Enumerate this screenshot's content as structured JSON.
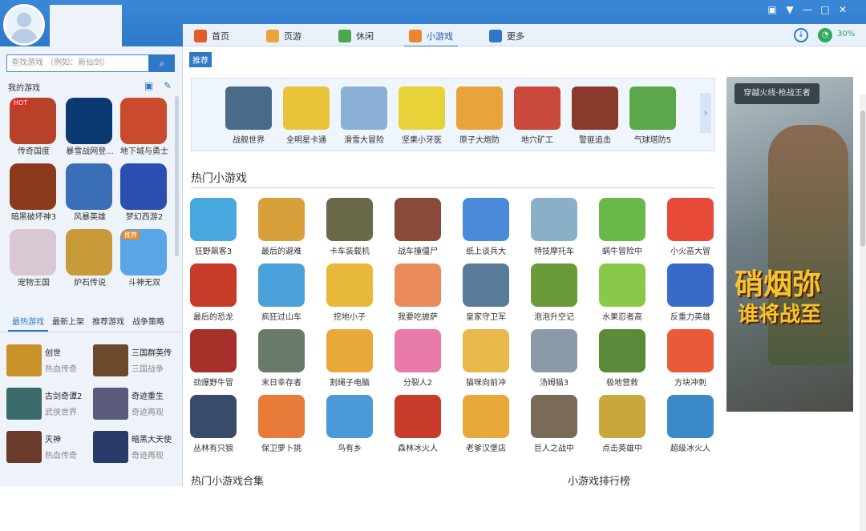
{
  "window": {
    "controls": [
      "gift-icon",
      "menu-icon",
      "minimize-icon",
      "maximize-icon",
      "close-icon"
    ]
  },
  "nav": {
    "tabs": [
      {
        "label": "首页",
        "icon": "home-icon",
        "color": "#e55a2b"
      },
      {
        "label": "页游",
        "icon": "page-game-icon",
        "color": "#e8a63a"
      },
      {
        "label": "休闲",
        "icon": "casual-icon",
        "color": "#4aa84a"
      },
      {
        "label": "小游戏",
        "icon": "mini-game-icon",
        "color": "#e8872b"
      },
      {
        "label": "更多",
        "icon": "more-icon",
        "color": "#2f78c8"
      }
    ],
    "active": "小游戏",
    "download_icon": "download-icon",
    "speed": "30%"
  },
  "sidebar": {
    "search_placeholder": "查找游戏 （例如：新仙剑）",
    "my_games_title": "我的游戏",
    "my_games": [
      {
        "label": "传奇国度",
        "color": "#b8412a",
        "hot": "HOT"
      },
      {
        "label": "暴雪战网登...",
        "color": "#0b3a72"
      },
      {
        "label": "地下城与勇士",
        "color": "#c94a2c"
      },
      {
        "label": "暗黑破坏神3",
        "color": "#8a3a1a"
      },
      {
        "label": "风暴英雄",
        "color": "#3a6fb8"
      },
      {
        "label": "梦幻西游2",
        "color": "#2a4fb0"
      },
      {
        "label": "宠物王国",
        "color": "#d9c7d4"
      },
      {
        "label": "炉石传说",
        "color": "#c99a3a"
      },
      {
        "label": "斗神无双",
        "color": "#5aa4e8",
        "hot": "推荐"
      }
    ],
    "tabs": [
      "最热游戏",
      "最新上架",
      "推荐游戏",
      "战争策略"
    ],
    "hot_games": [
      {
        "name": "创世",
        "sub": "热血传奇",
        "color": "#c8912a"
      },
      {
        "name": "三国群英传",
        "sub": "三国战争",
        "color": "#6a4a2a"
      },
      {
        "name": "古剑奇谭2",
        "sub": "武侠世界",
        "color": "#3a6a6a"
      },
      {
        "name": "奇迹重生",
        "sub": "奇迹再现",
        "color": "#5a5a7a"
      },
      {
        "name": "灭神",
        "sub": "热血传奇",
        "color": "#6a3a2a"
      },
      {
        "name": "暗黑大天使",
        "sub": "奇迹再现",
        "color": "#2a3a6a"
      }
    ]
  },
  "main": {
    "recommend_badge": "推荐",
    "featured": [
      {
        "label": "战舰世界",
        "color": "#4a6a8a"
      },
      {
        "label": "全明星卡通",
        "color": "#e8c43a"
      },
      {
        "label": "滑雪大冒险",
        "color": "#8ab0d8"
      },
      {
        "label": "坚果小牙医",
        "color": "#e8d23a"
      },
      {
        "label": "原子大炮防",
        "color": "#e8a43a"
      },
      {
        "label": "地穴矿工",
        "color": "#c94a3a"
      },
      {
        "label": "警匪追击",
        "color": "#8a3a2a"
      },
      {
        "label": "气球塔防5",
        "color": "#5aa84a"
      }
    ],
    "section_title": "热门小游戏",
    "games": [
      {
        "label": "狂野飙客3",
        "color": "#4aa8e0"
      },
      {
        "label": "最后的避难",
        "color": "#d8a03a"
      },
      {
        "label": "卡车装载机",
        "color": "#6a6a4a"
      },
      {
        "label": "战车撞僵尸",
        "color": "#8a4a3a"
      },
      {
        "label": "纸上谈兵大",
        "color": "#4a8ad8"
      },
      {
        "label": "特技摩托车",
        "color": "#8ab0c8"
      },
      {
        "label": "蜗牛冒险中",
        "color": "#6ab84a"
      },
      {
        "label": "小火苗大冒",
        "color": "#e84a3a"
      },
      {
        "label": "最后的恐龙",
        "color": "#c83a2a"
      },
      {
        "label": "疯狂过山车",
        "color": "#4aa0d8"
      },
      {
        "label": "挖地小子",
        "color": "#e8b83a"
      },
      {
        "label": "我要吃披萨",
        "color": "#e88a5a"
      },
      {
        "label": "皇家守卫军",
        "color": "#5a7a9a"
      },
      {
        "label": "泡泡升空记",
        "color": "#6a9a3a"
      },
      {
        "label": "水果忍者高",
        "color": "#8ac84a"
      },
      {
        "label": "反重力英雄",
        "color": "#3a6ac8"
      },
      {
        "label": "劲爆野牛冒",
        "color": "#a8302a"
      },
      {
        "label": "末日幸存者",
        "color": "#6a7a6a"
      },
      {
        "label": "割绳子电脑",
        "color": "#e8a83a"
      },
      {
        "label": "分裂人2",
        "color": "#e87aa8"
      },
      {
        "label": "猫咪向前冲",
        "color": "#e8b84a"
      },
      {
        "label": "汤姆猫3",
        "color": "#8a9aa8"
      },
      {
        "label": "极地营救",
        "color": "#5a8a3a"
      },
      {
        "label": "方块冲刺",
        "color": "#e85a3a"
      },
      {
        "label": "丛林有只狼",
        "color": "#3a4a6a"
      },
      {
        "label": "保卫萝卜挑",
        "color": "#e87a3a"
      },
      {
        "label": "鸟有乡",
        "color": "#4a9ad8"
      },
      {
        "label": "森林冰火人",
        "color": "#c83a2a"
      },
      {
        "label": "老爹汉堡店",
        "color": "#e8a83a"
      },
      {
        "label": "巨人之战中",
        "color": "#7a6a5a"
      },
      {
        "label": "点击英雄中",
        "color": "#c8a83a"
      },
      {
        "label": "超级冰火人",
        "color": "#3a8ac8"
      }
    ],
    "bottom_left": "热门小游戏合集",
    "bottom_right": "小游戏排行榜"
  },
  "ad": {
    "logo": "穿越火线·枪战王者",
    "line1": "硝烟弥",
    "line2": "谁将战至"
  }
}
